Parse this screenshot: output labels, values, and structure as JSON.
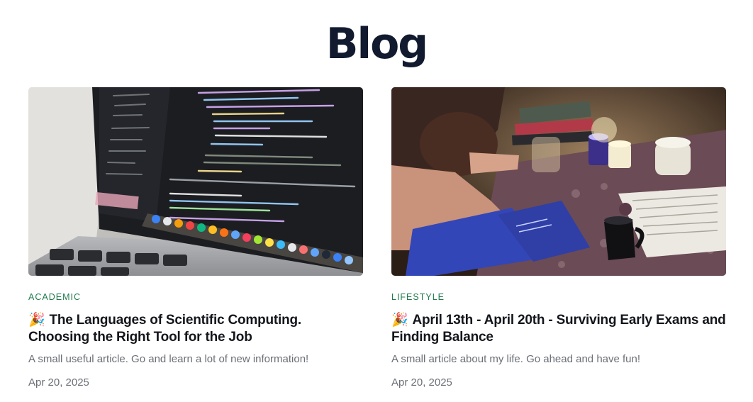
{
  "page": {
    "title": "Blog"
  },
  "posts": [
    {
      "category": "ACADEMIC",
      "emoji": "🎉",
      "title": "The Languages of Scientific Computing. Choosing the Right Tool for the Job",
      "excerpt": "A small useful article. Go and learn a lot of new information!",
      "date": "Apr 20, 2025",
      "image": "laptop-code-photo"
    },
    {
      "category": "LIFESTYLE",
      "emoji": "🎉",
      "title": "April 13th - April 20th - Surviving Early Exams and Finding Balance",
      "excerpt": "A small article about my life. Go ahead and have fun!",
      "date": "Apr 20, 2025",
      "image": "student-asleep-desk-photo"
    }
  ],
  "colors": {
    "title": "#111a2e",
    "category": "#1f7a4d",
    "muted_text": "#6b6f76",
    "heading_text": "#14161c"
  }
}
